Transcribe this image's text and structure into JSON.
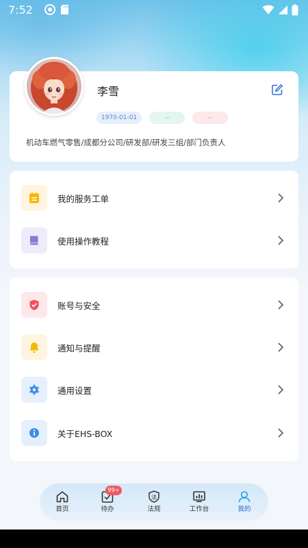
{
  "status_bar": {
    "time": "7:52"
  },
  "profile": {
    "name": "李雪",
    "birth_date": "1970-01-01",
    "tag_green": "--",
    "tag_red": "--",
    "organization": "机动车燃气零售/成都分公司/研发部/研发三组/部门负责人"
  },
  "menu_group_1": {
    "items": [
      {
        "label": "我的服务工单",
        "icon": "work-order-icon",
        "color": "#f5b800"
      },
      {
        "label": "使用操作教程",
        "icon": "book-icon",
        "color": "#8b78d9"
      }
    ]
  },
  "menu_group_2": {
    "items": [
      {
        "label": "账号与安全",
        "icon": "shield-icon",
        "color": "#f0525c"
      },
      {
        "label": "通知与提醒",
        "icon": "bell-icon",
        "color": "#f5b800"
      },
      {
        "label": "通用设置",
        "icon": "gear-icon",
        "color": "#3d8ee6"
      },
      {
        "label": "关于EHS-BOX",
        "icon": "info-icon",
        "color": "#3d8ee6"
      }
    ]
  },
  "tab_bar": {
    "tabs": [
      {
        "label": "首页",
        "icon": "home-icon"
      },
      {
        "label": "待办",
        "icon": "todo-icon"
      },
      {
        "label": "法规",
        "icon": "law-icon"
      },
      {
        "label": "工作台",
        "icon": "dashboard-icon"
      },
      {
        "label": "我的",
        "icon": "profile-icon"
      }
    ],
    "active_tab": "我的",
    "todo_badge": "99+"
  },
  "colors": {
    "accent": "#2a6bd9",
    "badge": "#ee5a63"
  }
}
